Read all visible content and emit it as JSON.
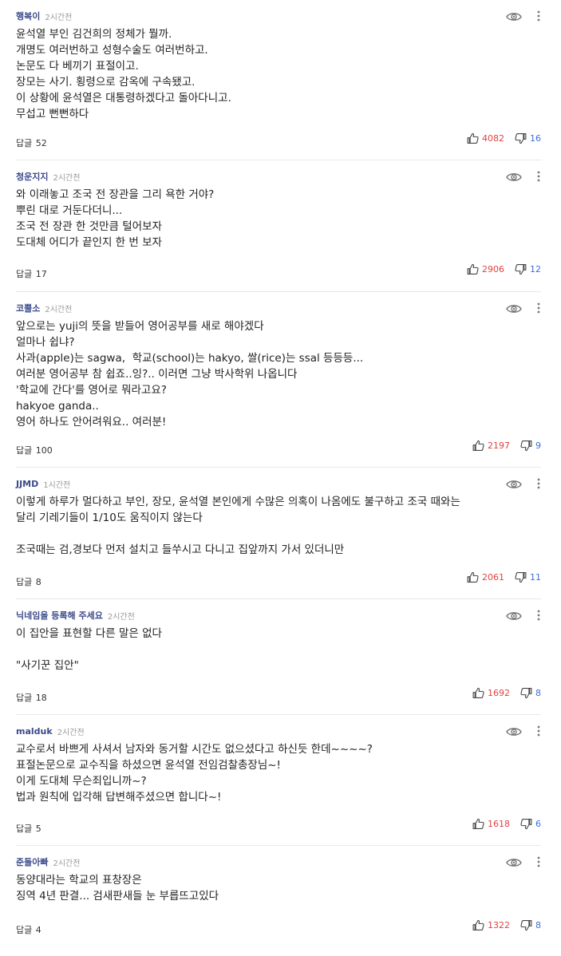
{
  "reply_label": "답글",
  "comments": [
    {
      "nickname": "행복이",
      "time": "2시간전",
      "lines": [
        "윤석열 부인 김건희의 정체가 뭘까.",
        "개명도 여러번하고 성형수술도 여러번하고.",
        "논문도 다 베끼기 표절이고.",
        "장모는 사기. 횡령으로 감옥에 구속됐고.",
        "이 상황에 윤석열은 대통령하겠다고 돌아다니고.",
        "무섭고 뻔뻔하다"
      ],
      "replies": "52",
      "likes": "4082",
      "dislikes": "16"
    },
    {
      "nickname": "청운지지",
      "time": "2시간전",
      "lines": [
        "와 이래놓고 조국 전 장관을 그리 욕한 거야?",
        "뿌린 대로 거둔다더니...",
        "조국 전 장관 한 것만큼 털어보자",
        "도대체 어디가 끝인지 한 번 보자"
      ],
      "replies": "17",
      "likes": "2906",
      "dislikes": "12"
    },
    {
      "nickname": "코뿔소",
      "time": "2시간전",
      "lines": [
        "앞으로는 yuji의 뜻을 받들어 영어공부를 새로 해야겠다",
        "얼마나 쉽냐?",
        "사과(apple)는 sagwa,  학교(school)는 hakyo, 쌀(rice)는 ssal 등등등...",
        "여러분 영어공부 참 쉽죠..잉?.. 이러면 그냥 박사학위 나옵니다",
        "'학교에 간다'를 영어로 뭐라고요?",
        "hakyoe ganda..",
        "영어 하나도 안어려워요.. 여러분!"
      ],
      "replies": "100",
      "likes": "2197",
      "dislikes": "9"
    },
    {
      "nickname": "JJMD",
      "time": "1시간전",
      "lines": [
        "이렇게 하루가 멀다하고 부인, 장모, 윤석열 본인에게 수많은 의혹이 나옴에도 불구하고 조국 때와는",
        "달리 기레기들이 1/10도 움직이지 않는다",
        "",
        "조국때는 검,경보다 먼저 설치고 들쑤시고 다니고 집앞까지 가서 있더니만"
      ],
      "replies": "8",
      "likes": "2061",
      "dislikes": "11"
    },
    {
      "nickname": "닉네임을 등록해 주세요",
      "time": "2시간전",
      "lines": [
        "이 집안을 표현할 다른 말은 없다",
        "",
        "\"사기꾼 집안\""
      ],
      "replies": "18",
      "likes": "1692",
      "dislikes": "8"
    },
    {
      "nickname": "malduk",
      "time": "2시간전",
      "lines": [
        "교수로서 바쁘게 사셔서 남자와 동거할 시간도 없으셨다고 하신듯 한데~~~~?",
        "표절논문으로 교수직을 하셨으면 윤석열 전임검찰총장님~!",
        "이게 도대체 무슨죄입니까~?",
        "법과 원칙에 입각해 답변해주셨으면 합니다~!"
      ],
      "replies": "5",
      "likes": "1618",
      "dislikes": "6"
    },
    {
      "nickname": "준돌아빠",
      "time": "2시간전",
      "lines": [
        "동양대라는 학교의 표창장은",
        "징역 4년 판결... 검새판새들 눈 부릅뜨고있다"
      ],
      "replies": "4",
      "likes": "1322",
      "dislikes": "8"
    }
  ]
}
